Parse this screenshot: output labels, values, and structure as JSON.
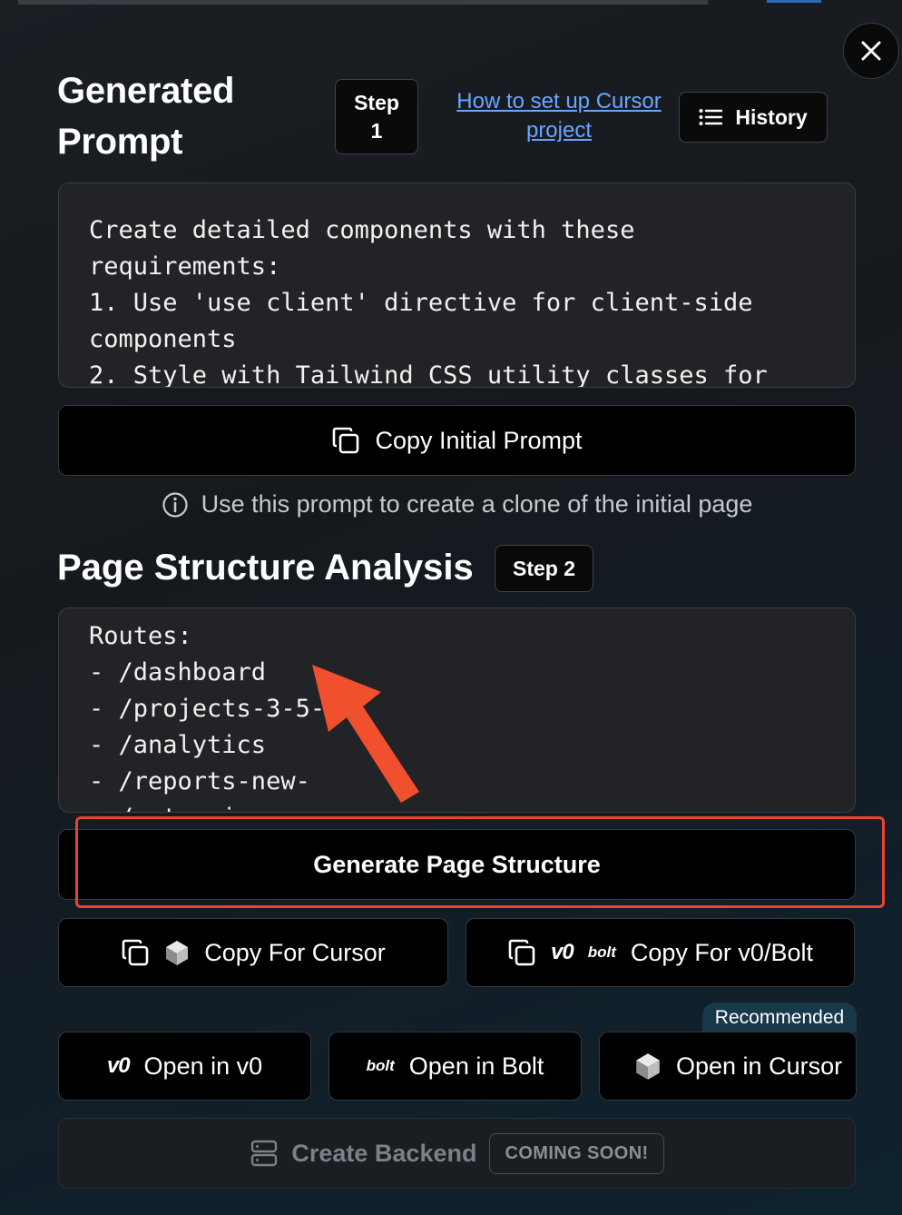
{
  "header": {
    "title": "Generated Prompt",
    "step1_label": "Step",
    "step1_number": "1",
    "howto_link": "How to set up Cursor project",
    "history_label": "History"
  },
  "prompt": {
    "text": "Create detailed components with these\nrequirements:\n1. Use 'use client' directive for client-side\ncomponents\n2. Style with Tailwind CSS utility classes for",
    "copy_label": "Copy Initial Prompt",
    "hint": "Use this prompt to create a clone of the initial page"
  },
  "structure": {
    "title": "Page Structure Analysis",
    "step_label": "Step 2",
    "text": "Routes:\n- /dashboard\n- /projects-3-5-\n- /analytics\n- /reports-new-\n- /extensions",
    "generate_label": "Generate Page Structure"
  },
  "actions": {
    "copy_cursor": "Copy For Cursor",
    "copy_v0bolt": "Copy For v0/Bolt",
    "recommended": "Recommended",
    "open_v0": "Open in v0",
    "open_bolt": "Open in Bolt",
    "open_cursor": "Open in Cursor",
    "backend": "Create Backend",
    "coming_soon": "COMING SOON!"
  },
  "logos": {
    "v0": "v0",
    "bolt": "bolt"
  },
  "colors": {
    "accent_link": "#6aa6ff",
    "highlight": "#e8452c",
    "arrow": "#f0502e"
  }
}
